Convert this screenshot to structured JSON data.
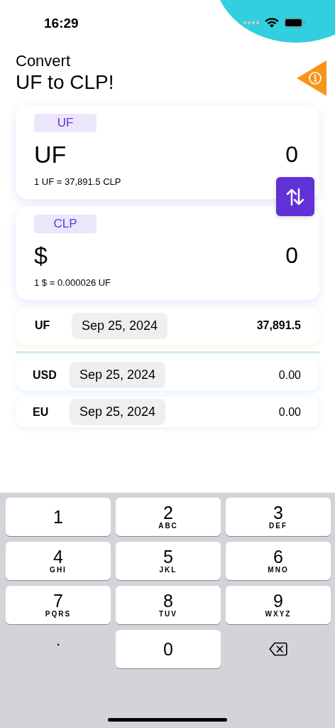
{
  "status_bar": {
    "time": "16:29"
  },
  "header": {
    "subtitle": "Convert",
    "title": "UF to CLP!"
  },
  "converters": [
    {
      "tag": "UF",
      "symbol": "UF",
      "amount": "0",
      "rate": "1 UF = 37,891.5 CLP"
    },
    {
      "tag": "CLP",
      "symbol": "$",
      "amount": "0",
      "rate": "1 $ = 0.000026 UF"
    }
  ],
  "rates": [
    {
      "currency": "UF",
      "date": "Sep 25, 2024",
      "value": "37,891.5",
      "primary": true
    },
    {
      "currency": "USD",
      "date": "Sep 25, 2024",
      "value": "0.00",
      "primary": false
    },
    {
      "currency": "EU",
      "date": "Sep 25, 2024",
      "value": "0.00",
      "primary": false
    }
  ],
  "keypad": [
    {
      "kind": "digit",
      "label": "1"
    },
    {
      "kind": "digit",
      "label": "2",
      "letters": "ABC"
    },
    {
      "kind": "digit",
      "label": "3",
      "letters": "DEF"
    },
    {
      "kind": "digit",
      "label": "4",
      "letters": "GHI"
    },
    {
      "kind": "digit",
      "label": "5",
      "letters": "JKL"
    },
    {
      "kind": "digit",
      "label": "6",
      "letters": "MNO"
    },
    {
      "kind": "digit",
      "label": "7",
      "letters": "PQRS"
    },
    {
      "kind": "digit",
      "label": "8",
      "letters": "TUV"
    },
    {
      "kind": "digit",
      "label": "9",
      "letters": "WXYZ"
    },
    {
      "kind": "plain",
      "label": "."
    },
    {
      "kind": "digit",
      "label": "0"
    },
    {
      "kind": "delete"
    }
  ]
}
